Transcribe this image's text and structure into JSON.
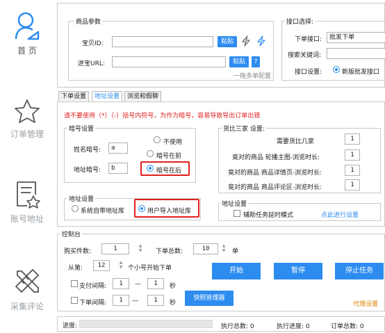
{
  "sidebar": {
    "items": [
      {
        "label": "首 页",
        "icon": "user-icon"
      },
      {
        "label": "订单管理",
        "icon": "star-icon"
      },
      {
        "label": "账号地址",
        "icon": "document-star-icon"
      },
      {
        "label": "采集评论",
        "icon": "ruler-pencil-icon"
      }
    ]
  },
  "product": {
    "legend": "商品参数",
    "baobei_label": "宝贝ID:",
    "baobei_value": "",
    "paste_label": "粘贴",
    "url_label": "进宝URL:",
    "url_value": "",
    "paste2_label": "粘贴",
    "help_label": "?",
    "note": "一拖多单配置"
  },
  "api": {
    "legend": "接口选择:",
    "order_api_label": "下单接口:",
    "order_api_value": "批发下单",
    "keyword_label": "搜索关键词:",
    "keyword_value": "",
    "settings_label": "接口设置:",
    "settings_option": "新版批发接口"
  },
  "tabs": [
    "下单设置",
    "地址设置",
    "浏览和假聊"
  ],
  "address_tab": {
    "warning": "请不要使用（*）（-）括号内符号，为作为暗号，容易导致导出订单出错",
    "secret": {
      "legend": "暗号设置",
      "name_label": "姓名暗号:",
      "name_value": "a",
      "addr_label": "地址暗号:",
      "addr_value": "b",
      "opt_none": "不使用",
      "opt_front": "暗号在前",
      "opt_back": "暗号在后"
    },
    "compare": {
      "legend": "货比三家 设置:",
      "need_label": "需要货比几家",
      "need_value": "1",
      "r1_label": "竟对的商品 轮播主图-浏览时长:",
      "r1_value": "1",
      "r2_label": "竟对的商品 商品详情页-浏览时长:",
      "r2_value": "1",
      "r3_label": "竟对的商品 商品评论区-浏览时长:",
      "r3_value": "1"
    },
    "addr_setting": {
      "legend": "地址设置",
      "opt_system": "系统自带地址库",
      "opt_user": "用户导入地址库"
    },
    "addr_setting2": {
      "legend": "地址设置",
      "assist_label": "辅助任务延时模式",
      "link": "点此进行设置"
    }
  },
  "console": {
    "legend": "控制台",
    "buy_label": "购买件数:",
    "buy_value": "1",
    "total_label": "下单总数:",
    "total_value": "10",
    "unit": "单",
    "from_label": "从第:",
    "from_value": "12",
    "from_suffix": "个小号开始下单",
    "start": "开始",
    "pause": "暂停",
    "stop": "停止任务",
    "pay_label": "支付间隔:",
    "pay_min": "1",
    "pay_dash": "—",
    "pay_max": "1",
    "pay_unit": "秒",
    "order_label": "下单间隔:",
    "order_min": "1",
    "order_dash": "—",
    "order_max": "1",
    "order_unit": "秒",
    "shortcut": "快照管理器",
    "proxy": "代理设置"
  },
  "status": {
    "progress_label": "进度:",
    "progress_value": 0,
    "exec_total": "执行总数: 0",
    "exec_progress": "执行进度: 0",
    "order_total": "订单总数: 0"
  },
  "colors": {
    "accent": "#2d8cf0",
    "warning": "#e02020",
    "highlight": "#e02020",
    "orange": "#d98500"
  }
}
